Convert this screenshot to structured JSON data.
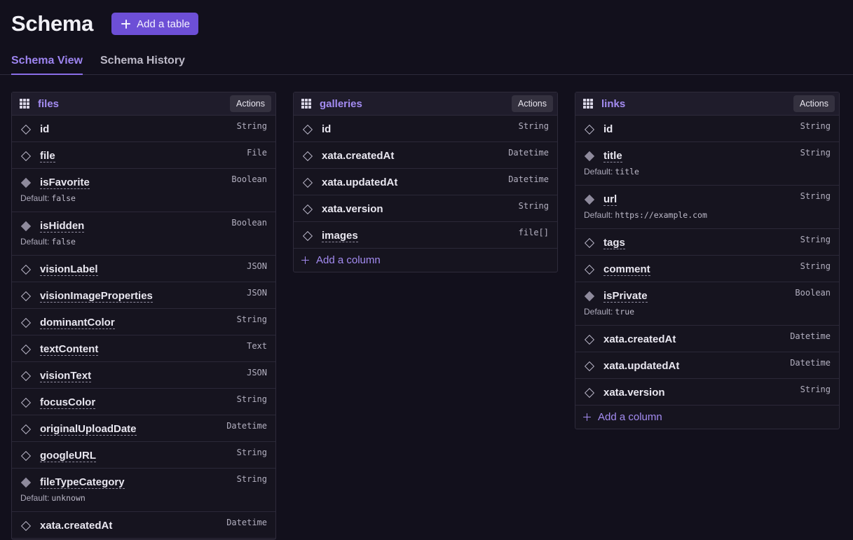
{
  "header": {
    "title": "Schema",
    "add_table_label": "Add a table"
  },
  "tabs": [
    {
      "label": "Schema View",
      "active": true
    },
    {
      "label": "Schema History",
      "active": false
    }
  ],
  "actions_label": "Actions",
  "add_column_label": "Add a column",
  "default_prefix": "Default:",
  "tables": [
    {
      "name": "files",
      "columns": [
        {
          "name": "id",
          "type": "String",
          "underline": false,
          "required": false
        },
        {
          "name": "file",
          "type": "File",
          "underline": true,
          "required": false
        },
        {
          "name": "isFavorite",
          "type": "Boolean",
          "underline": true,
          "required": true,
          "default": "false"
        },
        {
          "name": "isHidden",
          "type": "Boolean",
          "underline": true,
          "required": true,
          "default": "false"
        },
        {
          "name": "visionLabel",
          "type": "JSON",
          "underline": true,
          "required": false
        },
        {
          "name": "visionImageProperties",
          "type": "JSON",
          "underline": true,
          "required": false
        },
        {
          "name": "dominantColor",
          "type": "String",
          "underline": true,
          "required": false
        },
        {
          "name": "textContent",
          "type": "Text",
          "underline": true,
          "required": false
        },
        {
          "name": "visionText",
          "type": "JSON",
          "underline": true,
          "required": false
        },
        {
          "name": "focusColor",
          "type": "String",
          "underline": true,
          "required": false
        },
        {
          "name": "originalUploadDate",
          "type": "Datetime",
          "underline": true,
          "required": false
        },
        {
          "name": "googleURL",
          "type": "String",
          "underline": true,
          "required": false
        },
        {
          "name": "fileTypeCategory",
          "type": "String",
          "underline": true,
          "required": true,
          "default": "unknown"
        },
        {
          "name": "xata.createdAt",
          "type": "Datetime",
          "underline": false,
          "required": false
        }
      ],
      "show_add_column": false
    },
    {
      "name": "galleries",
      "columns": [
        {
          "name": "id",
          "type": "String",
          "underline": false,
          "required": false
        },
        {
          "name": "xata.createdAt",
          "type": "Datetime",
          "underline": false,
          "required": false
        },
        {
          "name": "xata.updatedAt",
          "type": "Datetime",
          "underline": false,
          "required": false
        },
        {
          "name": "xata.version",
          "type": "String",
          "underline": false,
          "required": false
        },
        {
          "name": "images",
          "type": "file[]",
          "underline": true,
          "required": false
        }
      ],
      "show_add_column": true
    },
    {
      "name": "links",
      "columns": [
        {
          "name": "id",
          "type": "String",
          "underline": false,
          "required": false
        },
        {
          "name": "title",
          "type": "String",
          "underline": true,
          "required": true,
          "default": "title"
        },
        {
          "name": "url",
          "type": "String",
          "underline": true,
          "required": true,
          "default": "https://example.com"
        },
        {
          "name": "tags",
          "type": "String",
          "underline": true,
          "required": false
        },
        {
          "name": "comment",
          "type": "String",
          "underline": true,
          "required": false
        },
        {
          "name": "isPrivate",
          "type": "Boolean",
          "underline": true,
          "required": true,
          "default": "true"
        },
        {
          "name": "xata.createdAt",
          "type": "Datetime",
          "underline": false,
          "required": false
        },
        {
          "name": "xata.updatedAt",
          "type": "Datetime",
          "underline": false,
          "required": false
        },
        {
          "name": "xata.version",
          "type": "String",
          "underline": false,
          "required": false
        }
      ],
      "show_add_column": true
    }
  ]
}
